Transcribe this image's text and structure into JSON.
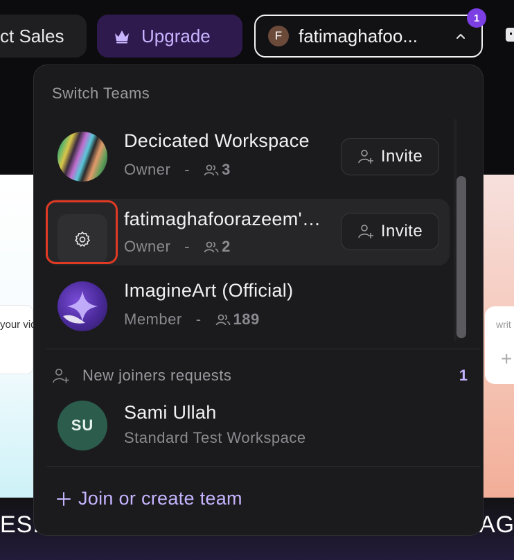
{
  "header": {
    "sales_label": "ct Sales",
    "upgrade_label": "Upgrade",
    "account": {
      "initial": "F",
      "name": "fatimaghafoo...",
      "notification_count": "1"
    }
  },
  "background": {
    "left_card_text": "your vid",
    "right_card_text": "writ",
    "right_card_plus": "+",
    "bottom_left_text": "ESIG",
    "bottom_right_text": "AG"
  },
  "dropdown": {
    "section_title": "Switch Teams",
    "teams": [
      {
        "name": "Decicated Workspace",
        "role": "Owner",
        "separator": "-",
        "members": "3",
        "invite_label": "Invite",
        "avatar": "holographic-image"
      },
      {
        "name": "fatimaghafoorazeem's Workspace",
        "role": "Owner",
        "separator": "-",
        "members": "2",
        "invite_label": "Invite",
        "avatar": "gear-icon"
      },
      {
        "name": "ImagineArt (Official)",
        "role": "Member",
        "separator": "-",
        "members": "189",
        "avatar": "imagineart-logo"
      }
    ],
    "requests": {
      "label": "New joiners requests",
      "count": "1",
      "items": [
        {
          "initials": "SU",
          "name": "Sami Ullah",
          "workspace": "Standard Test Workspace"
        }
      ]
    },
    "join_label": "Join or create team"
  },
  "colors": {
    "accent": "#c5b3ff",
    "badge": "#7b3fe4",
    "highlight": "#e03a24",
    "panel_bg": "#1b1b1d"
  }
}
